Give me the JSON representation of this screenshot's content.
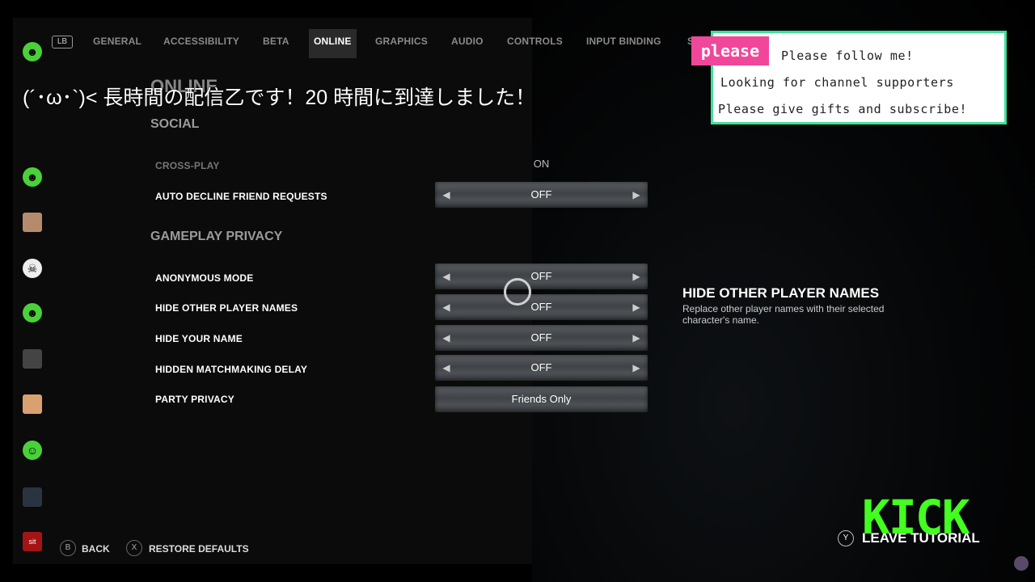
{
  "nav": {
    "bumper": "LB",
    "tabs": [
      {
        "label": "GENERAL"
      },
      {
        "label": "ACCESSIBILITY"
      },
      {
        "label": "BETA"
      },
      {
        "label": "ONLINE"
      },
      {
        "label": "GRAPHICS"
      },
      {
        "label": "AUDIO"
      },
      {
        "label": "CONTROLS"
      },
      {
        "label": "INPUT BINDING"
      },
      {
        "label": "S"
      }
    ],
    "active_tab": "ONLINE"
  },
  "page_heading": "ONLINE",
  "overlay_message": "(´･ω･`)< 長時間の配信乙です！20 時間に到達しました！",
  "sections": {
    "social": {
      "title": "SOCIAL",
      "rows": [
        {
          "label": "CROSS-PLAY",
          "value": "ON"
        },
        {
          "label": "AUTO DECLINE FRIEND REQUESTS",
          "value": "OFF"
        }
      ]
    },
    "privacy": {
      "title": "GAMEPLAY PRIVACY",
      "rows": [
        {
          "label": "ANONYMOUS MODE",
          "value": "OFF"
        },
        {
          "label": "HIDE OTHER PLAYER NAMES",
          "value": "OFF"
        },
        {
          "label": "HIDE YOUR NAME",
          "value": "OFF"
        },
        {
          "label": "HIDDEN MATCHMAKING DELAY",
          "value": "OFF"
        },
        {
          "label": "PARTY PRIVACY",
          "value": "Friends Only"
        }
      ]
    }
  },
  "description": {
    "title": "HIDE OTHER PLAYER NAMES",
    "body": "Replace other player names with their selected character's name."
  },
  "footer": {
    "back_button": "B",
    "back_label": "BACK",
    "restore_button": "X",
    "restore_label": "RESTORE DEFAULTS"
  },
  "promo": {
    "tag": "please",
    "lines": [
      "Please follow me!",
      "Looking for channel supporters",
      "Please give gifts and subscribe!"
    ]
  },
  "kick_logo": "KICK",
  "leave": {
    "button": "Y",
    "label": "LEAVE TUTORIAL"
  },
  "side_icons": [
    {
      "name": "green-emote-icon"
    },
    {
      "name": "green-headphones-emote-icon"
    },
    {
      "name": "anime-girl-emote-icon"
    },
    {
      "name": "skull-emote-icon"
    },
    {
      "name": "green-blob-emote-icon"
    },
    {
      "name": "dark-face-emote-icon"
    },
    {
      "name": "face-emote-icon"
    },
    {
      "name": "green-smile-emote-icon"
    },
    {
      "name": "person-emote-icon"
    },
    {
      "name": "sit-emote-icon",
      "text": "sit"
    }
  ]
}
